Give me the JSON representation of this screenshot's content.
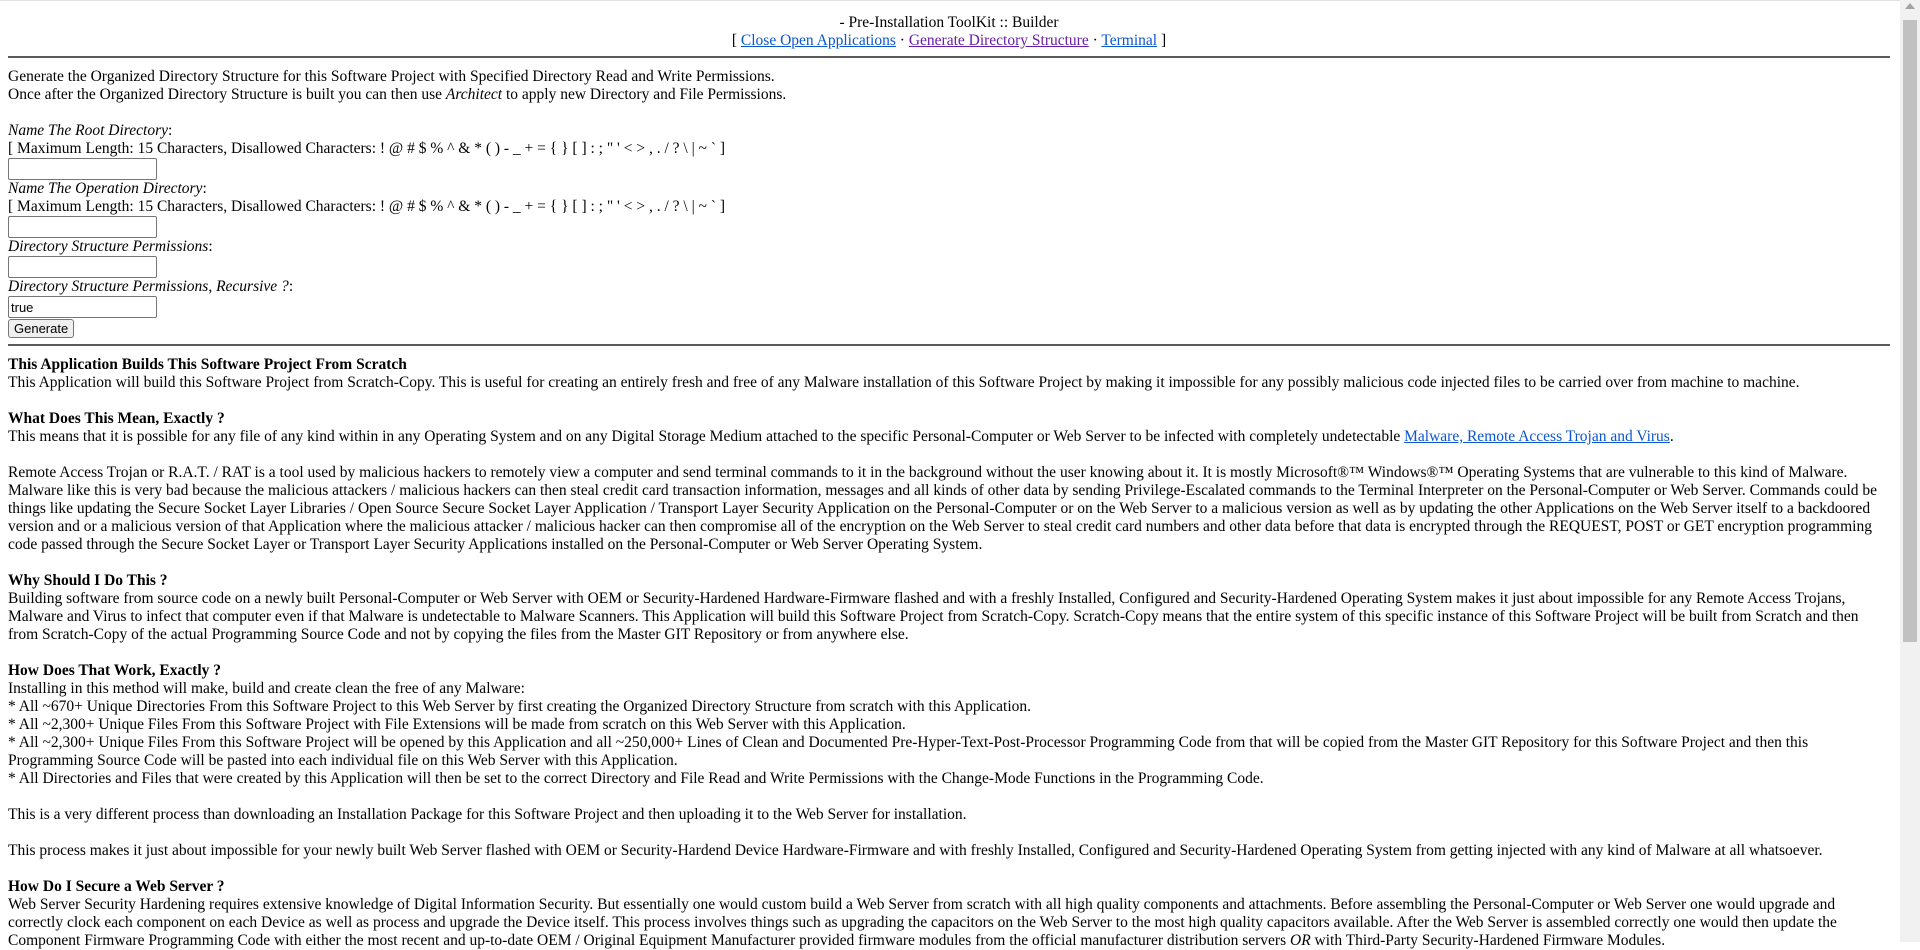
{
  "header": {
    "title": "- Pre-Installation ToolKit :: Builder",
    "bracket_open": "[ ",
    "bracket_close": " ]",
    "sep": " · ",
    "links": [
      "Close Open Applications",
      "Generate Directory Structure",
      "Terminal"
    ]
  },
  "intro": {
    "line1": "Generate the Organized Directory Structure for this Software Project with Specified Directory Read and Write Permissions.",
    "line2_a": "Once after the Organized Directory Structure is built you can then use ",
    "line2_em": "Architect",
    "line2_b": " to apply new Directory and File Permissions."
  },
  "form": {
    "root_label": "Name The Root Directory",
    "root_rule": "[ Maximum Length: 15 Characters, Disallowed Characters: ! @ # $ % ^ & * ( ) - _ + = { } [ ] : ; \" ' < > , . / ? \\ | ~ ` ]",
    "root_value": "",
    "op_label": "Name The Operation Directory",
    "op_rule": "[ Maximum Length: 15 Characters, Disallowed Characters: ! @ # $ % ^ & * ( ) - _ + = { } [ ] : ; \" ' < > , . / ? \\ | ~ ` ]",
    "op_value": "",
    "perm_label": "Directory Structure Permissions",
    "perm_value": "",
    "rec_label": "Directory Structure Permissions, Recursive ?",
    "rec_value": "true",
    "colon": ":",
    "button": "Generate"
  },
  "article": {
    "s1_title": "This Application Builds This Software Project From Scratch",
    "s1_text": "This Application will build this Software Project from Scratch-Copy. This is useful for creating an entirely fresh and free of any Malware installation of this Software Project by making it impossible for any possibly malicious code injected files to be carried over from machine to machine.",
    "s2_title": "What Does This Mean, Exactly ?",
    "s2_text": "This means that it is possible for any file of any kind within in any Operating System and on any Digital Storage Medium attached to the specific Personal-Computer or Web Server to be infected with completely undetectable ",
    "s2_link": "Malware, Remote Access Trojan and Virus",
    "s2_end": ".",
    "s2_p2": "Remote Access Trojan or R.A.T. / RAT is a tool used by malicious hackers to remotely view a computer and send terminal commands to it in the background without the user knowing about it. It is mostly Microsoft®™ Windows®™ Operating Systems that are vulnerable to this kind of Malware. Malware like this is very bad because the malicious attackers / malicious hackers can then steal credit card transaction information, messages and all kinds of other data by sending Privilege-Escalated commands to the Terminal Interpreter on the Personal-Computer or Web Server. Commands could be things like updating the Secure Socket Layer Libraries / Open Source Secure Socket Layer Application / Transport Layer Security Application on the Personal-Computer or on the Web Server to a malicious version as well as by updating the other Applications on the Web Server itself to a backdoored version and or a malicious version of that Application where the malicious attacker / malicious hacker can then compromise all of the encryption on the Web Server to steal credit card numbers and other data before that data is encrypted through the REQUEST, POST or GET encryption programming code passed through the Secure Socket Layer or Transport Layer Security Applications installed on the Personal-Computer or Web Server Operating System.",
    "s3_title": "Why Should I Do This ?",
    "s3_text": "Building software from source code on a newly built Personal-Computer or Web Server with OEM or Security-Hardened Hardware-Firmware flashed and with a freshly Installed, Configured and Security-Hardened Operating System makes it just about impossible for any Remote Access Trojans, Malware and Virus to infect that computer even if that Malware is undetectable to Malware Scanners. This Application will build this Software Project from Scratch-Copy. Scratch-Copy means that the entire system of this specific instance of this Software Project will be built from Scratch and then from Scratch-Copy of the actual Programming Source Code and not by copying the files from the Master GIT Repository or from anywhere else.",
    "s4_title": "How Does That Work, Exactly ?",
    "s4_intro": "Installing in this method will make, build and create clean the free of any Malware:",
    "s4_items": [
      "* All ~670+ Unique Directories From this Software Project to this Web Server by first creating the Organized Directory Structure from scratch with this Application.",
      "* All ~2,300+ Unique Files From this Software Project with File Extensions will be made from scratch on this Web Server with this Application.",
      "* All ~2,300+ Unique Files From this Software Project will be opened by this Application and all ~250,000+ Lines of Clean and Documented Pre-Hyper-Text-Post-Processor Programming Code from that will be copied from the Master GIT Repository for this Software Project and then this Programming Source Code will be pasted into each individual file on this Web Server with this Application.",
      "* All Directories and Files that were created by this Application will then be set to the correct Directory and File Read and Write Permissions with the Change-Mode Functions in the Programming Code."
    ],
    "s4_p2": "This is a very different process than downloading an Installation Package for this Software Project and then uploading it to the Web Server for installation.",
    "s4_p3": "This process makes it just about impossible for your newly built Web Server flashed with OEM or Security-Hardend Device Hardware-Firmware and with freshly Installed, Configured and Security-Hardened Operating System from getting injected with any kind of Malware at all whatsoever.",
    "s5_title": "How Do I Secure a Web Server ?",
    "s5_text_a": "Web Server Security Hardening requires extensive knowledge of Digital Information Security. But essentially one would custom build a Web Server from scratch with all high quality components and attachments. Before assembling the Personal-Computer or Web Server one would upgrade and correctly clock each component on each Device as well as process and upgrade the Device itself. This process involves things such as upgrading the capacitors on the Web Server to the most high quality capacitors available. After the Web Server is assembled correctly one would then update the Component Firmware Programming Code with either the most recent and up-to-date OEM / Original Equipment Manufacturer provided firmware modules from the official manufacturer distribution servers ",
    "s5_or": "OR",
    "s5_text_b": " with Third-Party Security-Hardened Firmware Modules."
  },
  "colors": {
    "link": "#0b57d0",
    "visited": "#681da8",
    "rule": "#5a5a5a"
  }
}
